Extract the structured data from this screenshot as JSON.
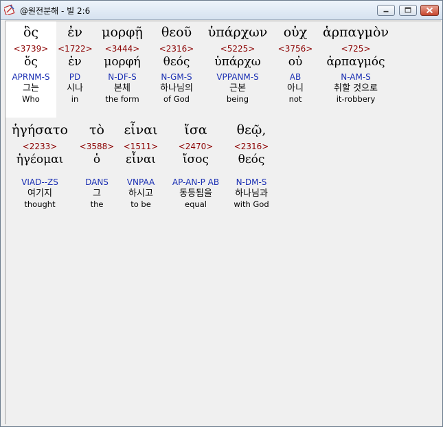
{
  "window": {
    "title": "@원전분해 - 빌 2:6",
    "buttons": {
      "minimize": "minimize",
      "maximize": "maximize",
      "close": "close"
    }
  },
  "rows": [
    {
      "words": [
        {
          "greek": "ὃς",
          "strong": "<3739>",
          "lemma": "ὅς",
          "parse": "APRNM-S",
          "korean": "그는",
          "english": "Who"
        },
        {
          "greek": "ἐν",
          "strong": "<1722>",
          "lemma": "ἐν",
          "parse": "PD",
          "korean": "시나",
          "english": "in"
        },
        {
          "greek": "μορφῇ",
          "strong": "<3444>",
          "lemma": "μορφή",
          "parse": "N-DF-S",
          "korean": "본체",
          "english": "the form"
        },
        {
          "greek": "θεοῦ",
          "strong": "<2316>",
          "lemma": "θεός",
          "parse": "N-GM-S",
          "korean": "하나님의",
          "english": "of God"
        },
        {
          "greek": "ὑπάρχων",
          "strong": "<5225>",
          "lemma": "ὑπάρχω",
          "parse": "VPPANM-S",
          "korean": "근본",
          "english": "being"
        },
        {
          "greek": "οὐχ",
          "strong": "<3756>",
          "lemma": "οὐ",
          "parse": "AB",
          "korean": "아니",
          "english": "not"
        },
        {
          "greek": "ἁρπαγμὸν",
          "strong": "<725>",
          "lemma": "ἁρπαγμός",
          "parse": "N-AM-S",
          "korean": "취할 것으로",
          "english": "it-robbery"
        }
      ]
    },
    {
      "words": [
        {
          "greek": "ἡγήσατο",
          "strong": "<2233>",
          "lemma": "ἡγέομαι",
          "parse": "VIAD--ZS",
          "korean": "여기지",
          "english": "thought"
        },
        {
          "greek": "τὸ",
          "strong": "<3588>",
          "lemma": "ὁ",
          "parse": "DANS",
          "korean": "그",
          "english": "the"
        },
        {
          "greek": "εἶναι",
          "strong": "<1511>",
          "lemma": "εἶναι",
          "parse": "VNPAA",
          "korean": "하시고",
          "english": "to be"
        },
        {
          "greek": "ἴσα",
          "strong": "<2470>",
          "lemma": "ἴσος",
          "parse": "AP-AN-P AB",
          "korean": "동등됨을",
          "english": "equal"
        },
        {
          "greek": "θεῷ,",
          "strong": "<2316>",
          "lemma": "θεός",
          "parse": "N-DM-S",
          "korean": "하나님과",
          "english": "with God"
        }
      ]
    }
  ]
}
